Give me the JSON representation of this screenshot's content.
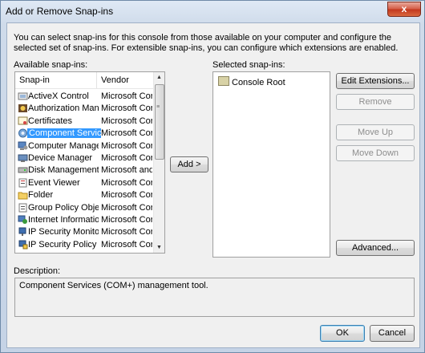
{
  "window": {
    "title": "Add or Remove Snap-ins",
    "close_glyph": "x"
  },
  "intro_text": "You can select snap-ins for this console from those available on your computer and configure the selected set of snap-ins. For extensible snap-ins, you can configure which extensions are enabled.",
  "available": {
    "label": "Available snap-ins:",
    "col_snapin": "Snap-in",
    "col_vendor": "Vendor",
    "rows": [
      {
        "name": "ActiveX Control",
        "vendor": "Microsoft Cor...",
        "icon": "activex-icon"
      },
      {
        "name": "Authorization Manager",
        "vendor": "Microsoft Cor...",
        "icon": "authorization-icon"
      },
      {
        "name": "Certificates",
        "vendor": "Microsoft Cor...",
        "icon": "certificates-icon"
      },
      {
        "name": "Component Services",
        "vendor": "Microsoft Cor...",
        "icon": "component-services-icon"
      },
      {
        "name": "Computer Managem...",
        "vendor": "Microsoft Cor...",
        "icon": "computer-management-icon"
      },
      {
        "name": "Device Manager",
        "vendor": "Microsoft Cor...",
        "icon": "device-manager-icon"
      },
      {
        "name": "Disk Management",
        "vendor": "Microsoft and...",
        "icon": "disk-management-icon"
      },
      {
        "name": "Event Viewer",
        "vendor": "Microsoft Cor...",
        "icon": "event-viewer-icon"
      },
      {
        "name": "Folder",
        "vendor": "Microsoft Cor...",
        "icon": "folder-icon"
      },
      {
        "name": "Group Policy Object ...",
        "vendor": "Microsoft Cor...",
        "icon": "group-policy-icon"
      },
      {
        "name": "Internet Informatio...",
        "vendor": "Microsoft Cor...",
        "icon": "iis-icon"
      },
      {
        "name": "IP Security Monitor",
        "vendor": "Microsoft Cor...",
        "icon": "ip-security-monitor-icon"
      },
      {
        "name": "IP Security Policy M...",
        "vendor": "Microsoft Cor...",
        "icon": "ip-security-policy-icon"
      }
    ],
    "selected_index": 3
  },
  "selected": {
    "label": "Selected snap-ins:",
    "items": [
      "Console Root"
    ]
  },
  "buttons": {
    "add": "Add >",
    "edit_extensions": "Edit Extensions...",
    "remove": "Remove",
    "move_up": "Move Up",
    "move_down": "Move Down",
    "advanced": "Advanced...",
    "ok": "OK",
    "cancel": "Cancel"
  },
  "description": {
    "label": "Description:",
    "text": "Component Services (COM+) management tool."
  },
  "colors": {
    "selection": "#3399ff",
    "close_button": "#c2361d"
  }
}
